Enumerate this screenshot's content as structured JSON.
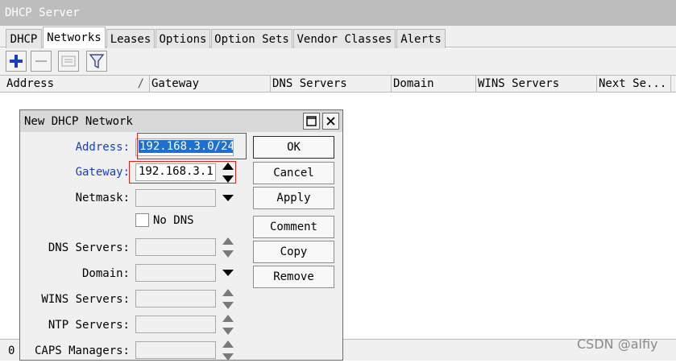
{
  "window": {
    "title": "DHCP Server"
  },
  "tabs": [
    {
      "label": "DHCP"
    },
    {
      "label": "Networks"
    },
    {
      "label": "Leases"
    },
    {
      "label": "Options"
    },
    {
      "label": "Option Sets"
    },
    {
      "label": "Vendor Classes"
    },
    {
      "label": "Alerts"
    }
  ],
  "active_tab": "Networks",
  "toolbar": {
    "add_icon": "plus-icon",
    "remove_icon": "minus-icon",
    "comment_icon": "note-icon",
    "filter_icon": "filter-icon",
    "add_color": "#1a3ec0"
  },
  "columns": [
    {
      "label": "Address"
    },
    {
      "label": "Gateway"
    },
    {
      "label": "DNS Servers"
    },
    {
      "label": "Domain"
    },
    {
      "label": "WINS Servers"
    },
    {
      "label": "Next Se..."
    }
  ],
  "status": {
    "count": "0"
  },
  "dialog": {
    "title": "New DHCP Network",
    "fields": {
      "address": {
        "label": "Address:",
        "value": "192.168.3.0/24"
      },
      "gateway": {
        "label": "Gateway:",
        "value": "192.168.3.1"
      },
      "netmask": {
        "label": "Netmask:",
        "value": ""
      },
      "no_dns": {
        "label": "No DNS",
        "checked": false
      },
      "dns_servers": {
        "label": "DNS Servers:",
        "value": ""
      },
      "domain": {
        "label": "Domain:",
        "value": ""
      },
      "wins_servers": {
        "label": "WINS Servers:",
        "value": ""
      },
      "ntp_servers": {
        "label": "NTP Servers:",
        "value": ""
      },
      "caps_managers": {
        "label": "CAPS Managers:",
        "value": ""
      }
    },
    "buttons": {
      "ok": "OK",
      "cancel": "Cancel",
      "apply": "Apply",
      "comment": "Comment",
      "copy": "Copy",
      "remove": "Remove"
    }
  },
  "watermark": "CSDN @alfiy",
  "colors": {
    "label_highlight": "#1a3ec0",
    "annotation_box": "#e02020",
    "selection": "#1e6fd0"
  }
}
